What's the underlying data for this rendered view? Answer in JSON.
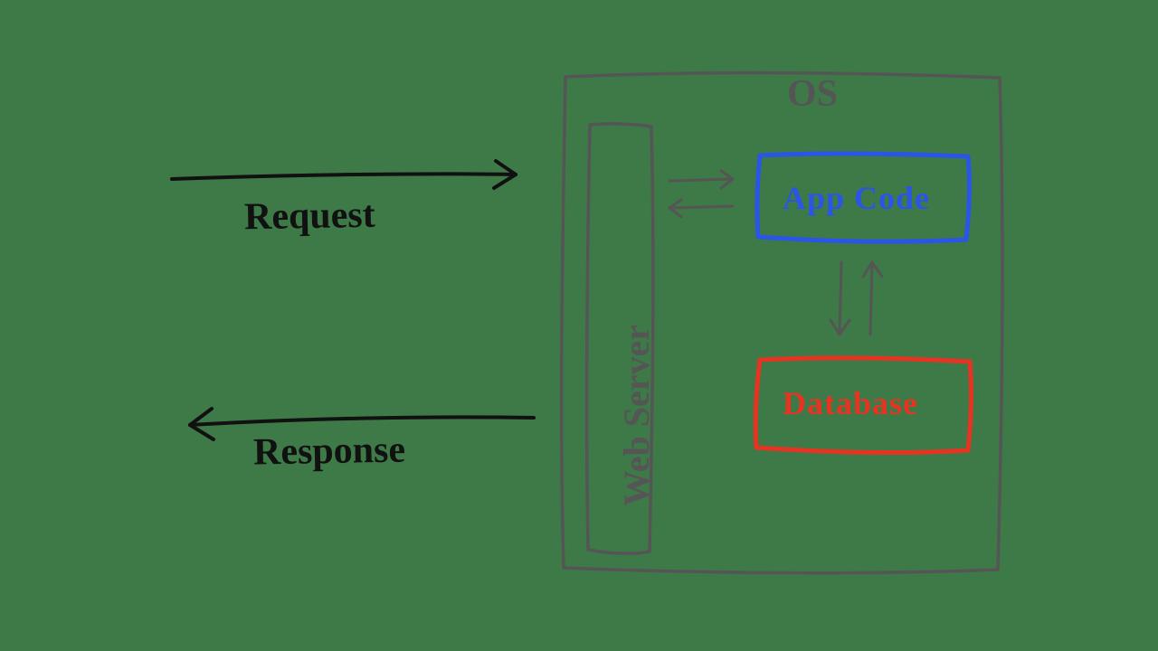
{
  "diagram": {
    "request_label": "Request",
    "response_label": "Response",
    "os_label": "OS",
    "web_server_label": "Web Server",
    "app_code_label": "App Code",
    "database_label": "Database",
    "colors": {
      "background": "#3e7a47",
      "ink": "#111111",
      "pencil": "#555555",
      "app_code": "#2b54e8",
      "database": "#e73321"
    }
  }
}
